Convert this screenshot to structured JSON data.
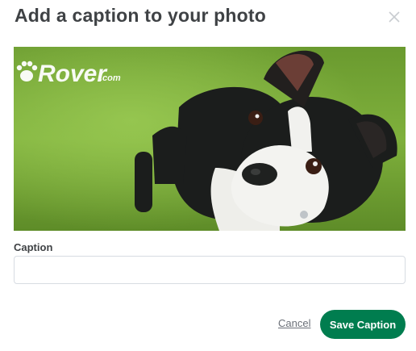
{
  "dialog": {
    "title": "Add a caption to your photo",
    "close_icon": "close-icon"
  },
  "photo": {
    "watermark_text": "Rover",
    "watermark_suffix": ".com",
    "watermark_icon": "paw-icon"
  },
  "caption": {
    "label": "Caption",
    "value": "",
    "placeholder": ""
  },
  "actions": {
    "cancel_label": "Cancel",
    "save_label": "Save Caption"
  },
  "colors": {
    "primary": "#007d4f",
    "text": "#3f4245",
    "border": "#d7dce2"
  }
}
